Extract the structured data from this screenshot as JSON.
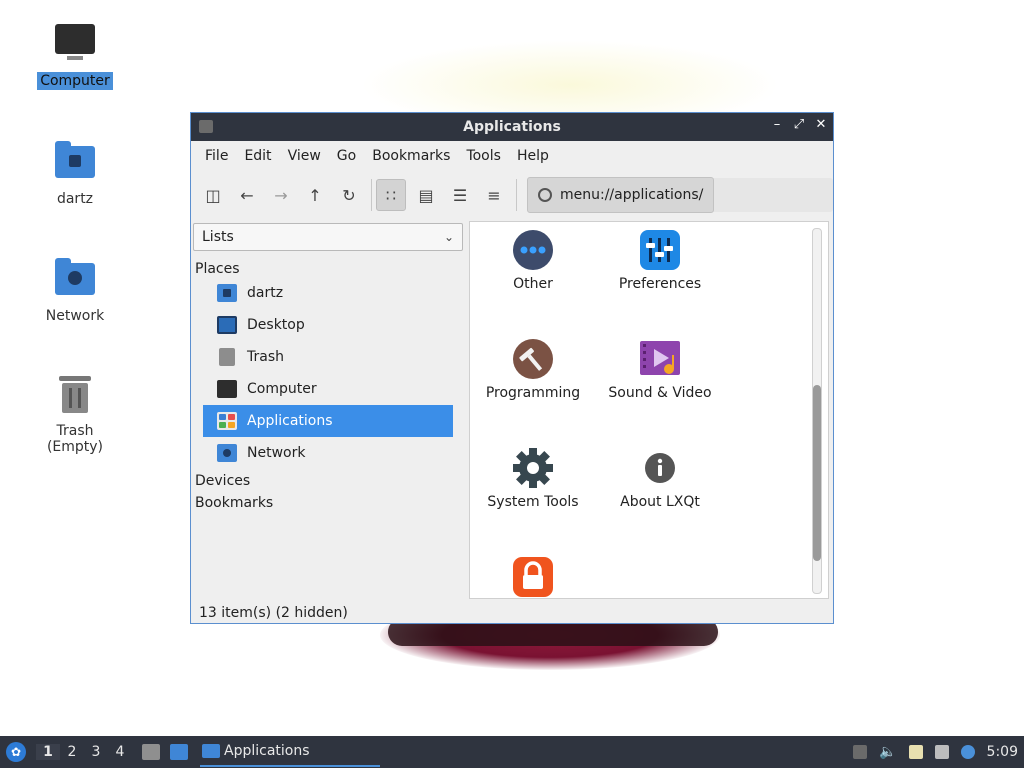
{
  "desktop": {
    "icons": [
      {
        "label": "Computer",
        "icon": "computer-icon",
        "selected": true
      },
      {
        "label": "dartz",
        "icon": "home-folder-icon"
      },
      {
        "label": "Network",
        "icon": "network-folder-icon"
      },
      {
        "label": "Trash (Empty)",
        "icon": "trash-icon"
      }
    ]
  },
  "window": {
    "title": "Applications",
    "menu": [
      "File",
      "Edit",
      "View",
      "Go",
      "Bookmarks",
      "Tools",
      "Help"
    ],
    "toolbar": {
      "buttons": [
        "new-tab-icon",
        "back-icon",
        "forward-icon",
        "up-icon",
        "reload-icon",
        "icon-view-icon",
        "thumbnail-view-icon",
        "compact-view-icon",
        "detailed-list-view-icon"
      ],
      "active_view": "icon-view-icon"
    },
    "path": "menu://applications/",
    "side_pane": {
      "mode": "Lists",
      "sections": {
        "places": "Places",
        "devices": "Devices",
        "bookmarks": "Bookmarks"
      },
      "places": [
        {
          "label": "dartz"
        },
        {
          "label": "Desktop"
        },
        {
          "label": "Trash"
        },
        {
          "label": "Computer"
        },
        {
          "label": "Applications",
          "selected": true
        },
        {
          "label": "Network"
        }
      ]
    },
    "items": [
      {
        "label": "Other",
        "icon": "other-icon",
        "color": "#3d4b6b"
      },
      {
        "label": "Preferences",
        "icon": "preferences-icon",
        "color": "#1e88e5"
      },
      {
        "label": "Programming",
        "icon": "programming-icon",
        "color": "#7b5244"
      },
      {
        "label": "Sound & Video",
        "icon": "sound-video-icon",
        "color": "#8e44ad"
      },
      {
        "label": "System Tools",
        "icon": "system-tools-icon",
        "color": "#37474f"
      },
      {
        "label": "About LXQt",
        "icon": "about-icon",
        "color": "#555555"
      },
      {
        "label": "",
        "icon": "lock-icon",
        "color": "#f0541e"
      }
    ],
    "status": "13 item(s) (2 hidden)"
  },
  "taskbar": {
    "workspaces": [
      "1",
      "2",
      "3",
      "4"
    ],
    "current_workspace": "1",
    "task": "Applications",
    "clock": "5:09"
  },
  "colors": {
    "titlebar": "#2f343f",
    "selection": "#3b8ee8",
    "folder": "#3f86d6"
  }
}
